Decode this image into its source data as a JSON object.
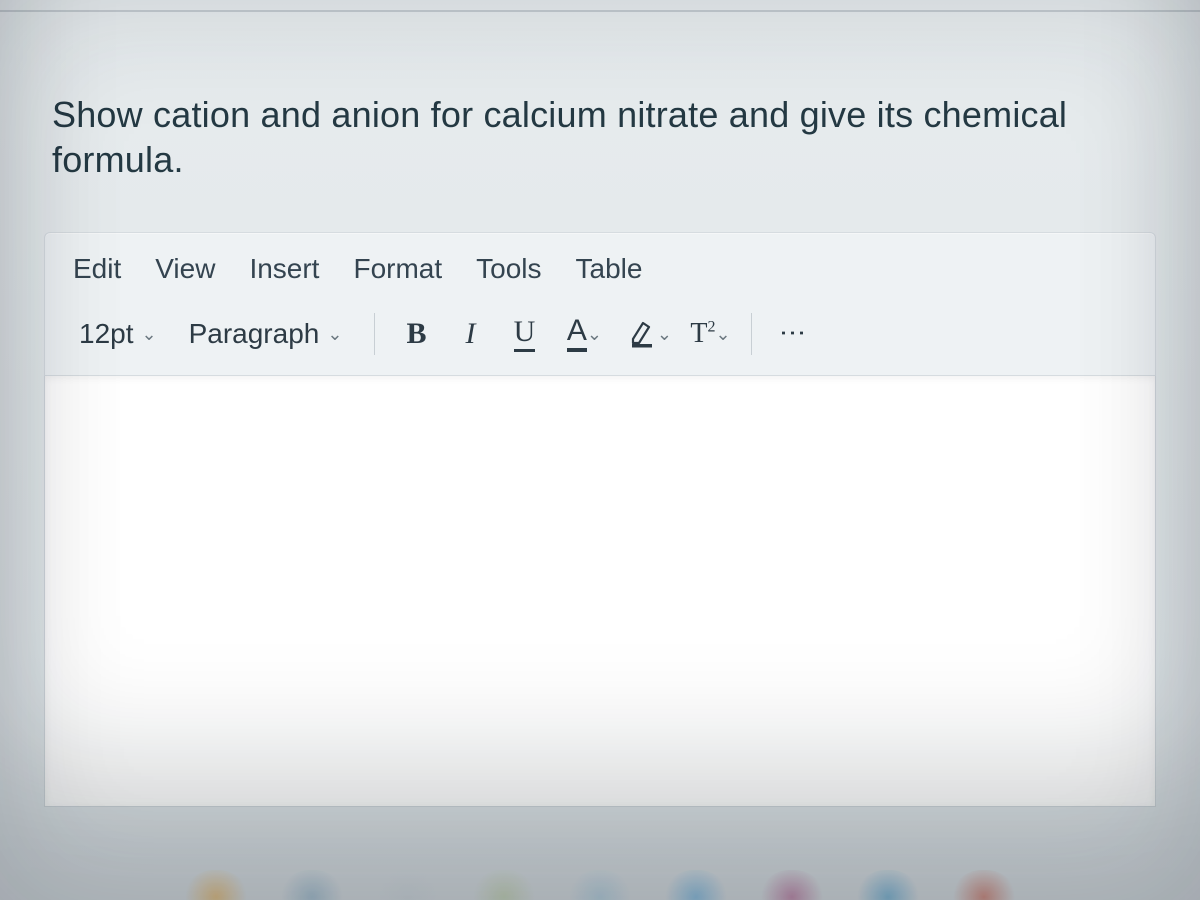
{
  "prompt": "Show cation and anion for calcium nitrate and give its chemical formula.",
  "menu": {
    "items": [
      "Edit",
      "View",
      "Insert",
      "Format",
      "Tools",
      "Table"
    ]
  },
  "toolbar": {
    "font_size": "12pt",
    "block_format": "Paragraph",
    "bold": "B",
    "italic": "I",
    "underline": "U",
    "text_color": "A",
    "superscript": "T",
    "superscript_exp": "2",
    "more": "⋮"
  },
  "editor": {
    "content": ""
  }
}
